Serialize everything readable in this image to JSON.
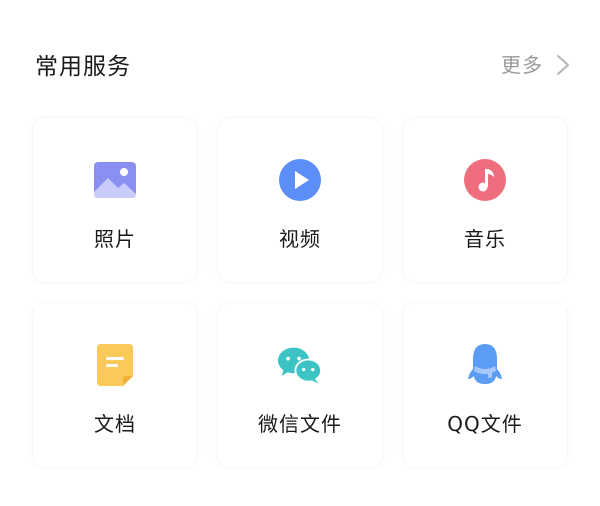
{
  "section": {
    "title": "常用服务",
    "more_label": "更多"
  },
  "services": [
    {
      "label": "照片",
      "icon": "photo-icon",
      "color": "#8B8FF2"
    },
    {
      "label": "视频",
      "icon": "video-icon",
      "color": "#5B8EF7"
    },
    {
      "label": "音乐",
      "icon": "music-icon",
      "color": "#EE6E7F"
    },
    {
      "label": "文档",
      "icon": "document-icon",
      "color": "#F9C95A"
    },
    {
      "label": "微信文件",
      "icon": "wechat-icon",
      "color": "#3CC3C3"
    },
    {
      "label": "QQ文件",
      "icon": "qq-icon",
      "color": "#5B9CF5"
    }
  ]
}
